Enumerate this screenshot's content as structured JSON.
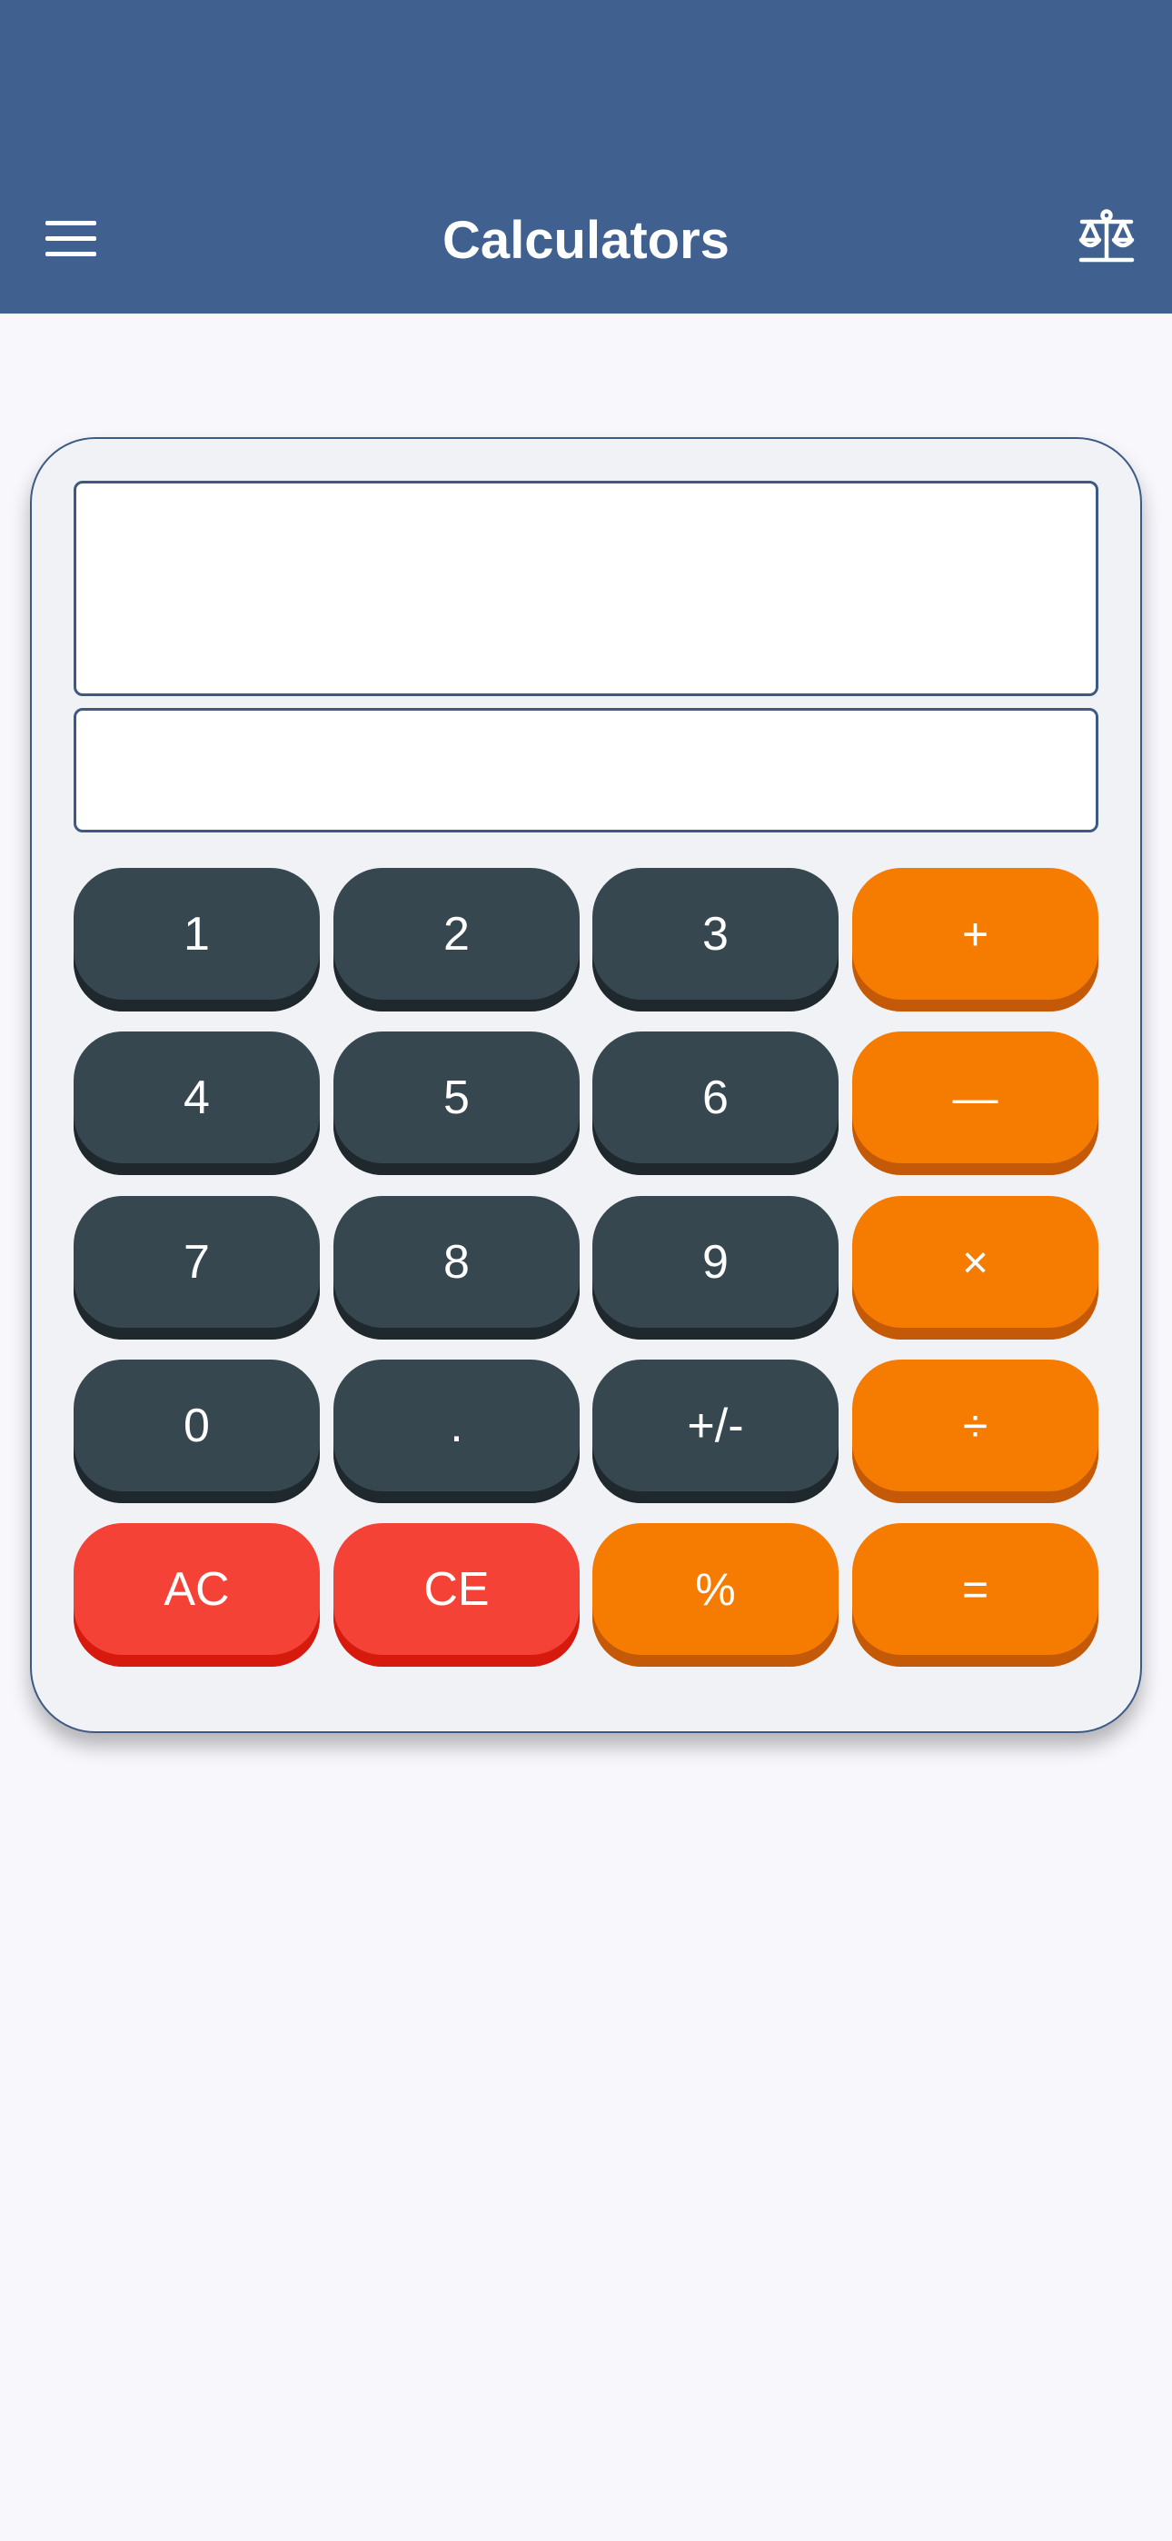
{
  "app_bar": {
    "title": "Calculators",
    "menu_icon": "hamburger-menu-icon",
    "right_icon": "balance-scale-icon"
  },
  "display": {
    "expression": "",
    "result": ""
  },
  "keypad": {
    "rows": [
      [
        {
          "label": "1",
          "kind": "digit"
        },
        {
          "label": "2",
          "kind": "digit"
        },
        {
          "label": "3",
          "kind": "digit"
        },
        {
          "label": "+",
          "kind": "operator"
        }
      ],
      [
        {
          "label": "4",
          "kind": "digit"
        },
        {
          "label": "5",
          "kind": "digit"
        },
        {
          "label": "6",
          "kind": "digit"
        },
        {
          "label": "—",
          "kind": "operator"
        }
      ],
      [
        {
          "label": "7",
          "kind": "digit"
        },
        {
          "label": "8",
          "kind": "digit"
        },
        {
          "label": "9",
          "kind": "digit"
        },
        {
          "label": "×",
          "kind": "operator"
        }
      ],
      [
        {
          "label": "0",
          "kind": "digit"
        },
        {
          "label": ".",
          "kind": "digit"
        },
        {
          "label": "+/-",
          "kind": "digit"
        },
        {
          "label": "÷",
          "kind": "operator"
        }
      ],
      [
        {
          "label": "AC",
          "kind": "clear"
        },
        {
          "label": "CE",
          "kind": "clear"
        },
        {
          "label": "%",
          "kind": "operator"
        },
        {
          "label": "=",
          "kind": "operator"
        }
      ]
    ]
  },
  "colors": {
    "app_bar": "#40608f",
    "digit_key": "#37474f",
    "operator_key": "#f57c00",
    "clear_key": "#f44336",
    "background": "#f7f7fc"
  }
}
